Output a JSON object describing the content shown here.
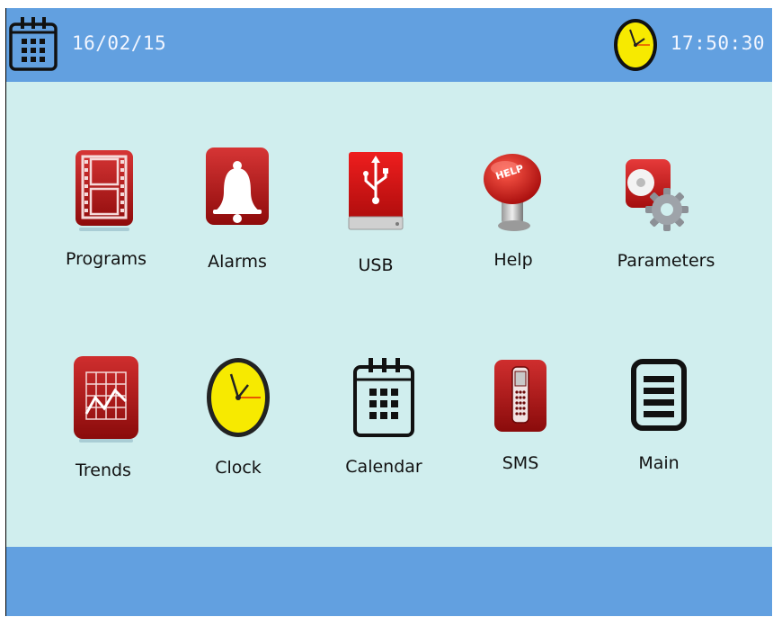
{
  "header": {
    "date": "16/02/15",
    "time": "17:50:30",
    "calendar_icon": "calendar-icon",
    "clock_icon": "clock-icon"
  },
  "menu": {
    "items": [
      {
        "label": "Programs",
        "icon": "film-strip-icon"
      },
      {
        "label": "Alarms",
        "icon": "bell-icon"
      },
      {
        "label": "USB",
        "icon": "usb-drive-icon"
      },
      {
        "label": "Help",
        "icon": "help-button-icon"
      },
      {
        "label": "Parameters",
        "icon": "gear-icon"
      },
      {
        "label": "Trends",
        "icon": "trend-chart-icon"
      },
      {
        "label": "Clock",
        "icon": "clock-icon"
      },
      {
        "label": "Calendar",
        "icon": "calendar-icon"
      },
      {
        "label": "SMS",
        "icon": "mobile-phone-icon"
      },
      {
        "label": "Main",
        "icon": "document-icon"
      }
    ]
  },
  "colors": {
    "bar": "#62a0e0",
    "background": "#d0eeee",
    "icon_red": "#b01515",
    "clock_yellow": "#f7ea00"
  }
}
